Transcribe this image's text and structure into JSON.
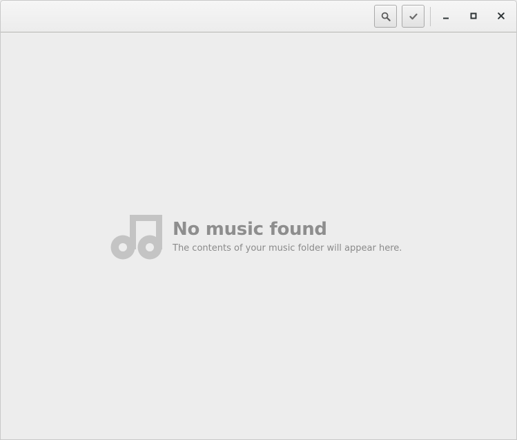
{
  "headerbar": {
    "search_icon": "search-icon",
    "select_icon": "checkmark-icon",
    "window_controls": {
      "minimize_icon": "minimize-icon",
      "maximize_icon": "maximize-icon",
      "close_icon": "close-icon"
    }
  },
  "empty_state": {
    "icon": "music-note-icon",
    "title": "No music found",
    "subtitle": "The contents of your music folder will appear here."
  },
  "colors": {
    "background": "#ededed",
    "header_background": "#f0f0f0",
    "empty_text": "#8e8e8e",
    "empty_icon": "#c4c4c4"
  }
}
